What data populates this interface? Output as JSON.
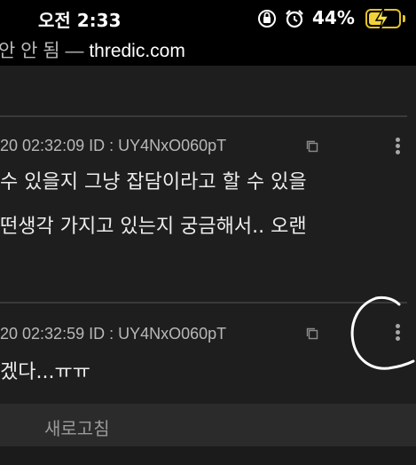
{
  "status_bar": {
    "time": "오전 2:33",
    "battery_percent": "44%"
  },
  "browser": {
    "page_title_prefix": "안 안 됨 — ",
    "domain": "thredic.com"
  },
  "posts": [
    {
      "meta": "20 02:32:09 ID : UY4NxO060pT",
      "lines": [
        "수 있을지 그냥 잡담이라고 할 수 있을",
        "떤생각 가지고 있는지 궁금해서.. 오랜"
      ]
    },
    {
      "meta": "20 02:32:59 ID : UY4NxO060pT",
      "lines": [
        "겠다...ㅠㅠ"
      ]
    }
  ],
  "actions": {
    "refresh_label": "새로고침"
  },
  "icons": [
    "orientation-lock-icon",
    "alarm-icon",
    "battery-icon",
    "charging-bolt-icon",
    "copy-icon",
    "more-vertical-icon"
  ],
  "colors": {
    "battery": "#f2d23a",
    "background": "#1e1e1e"
  }
}
